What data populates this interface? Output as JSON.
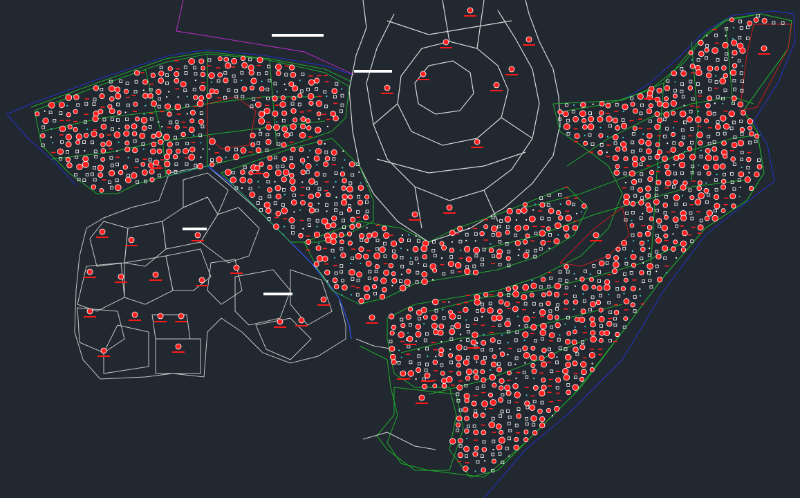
{
  "canvas": {
    "background": "#212830"
  },
  "colors": {
    "road_white": "#d9d9d9",
    "road_grey": "#b8b8b8",
    "boundary_green": "#1fae2b",
    "boundary_blue": "#2233cc",
    "boundary_magenta": "#c02ccc",
    "lot_red": "#ff2020",
    "lot_label_red": "#ff1a1a",
    "lot_white": "#ffffff",
    "lot_cyan": "#3fd0e0",
    "marker_white": "#ffffff"
  },
  "layers": {
    "plan_view": "cad-site-plan",
    "marker_bars": 3,
    "lot_density": "high"
  }
}
